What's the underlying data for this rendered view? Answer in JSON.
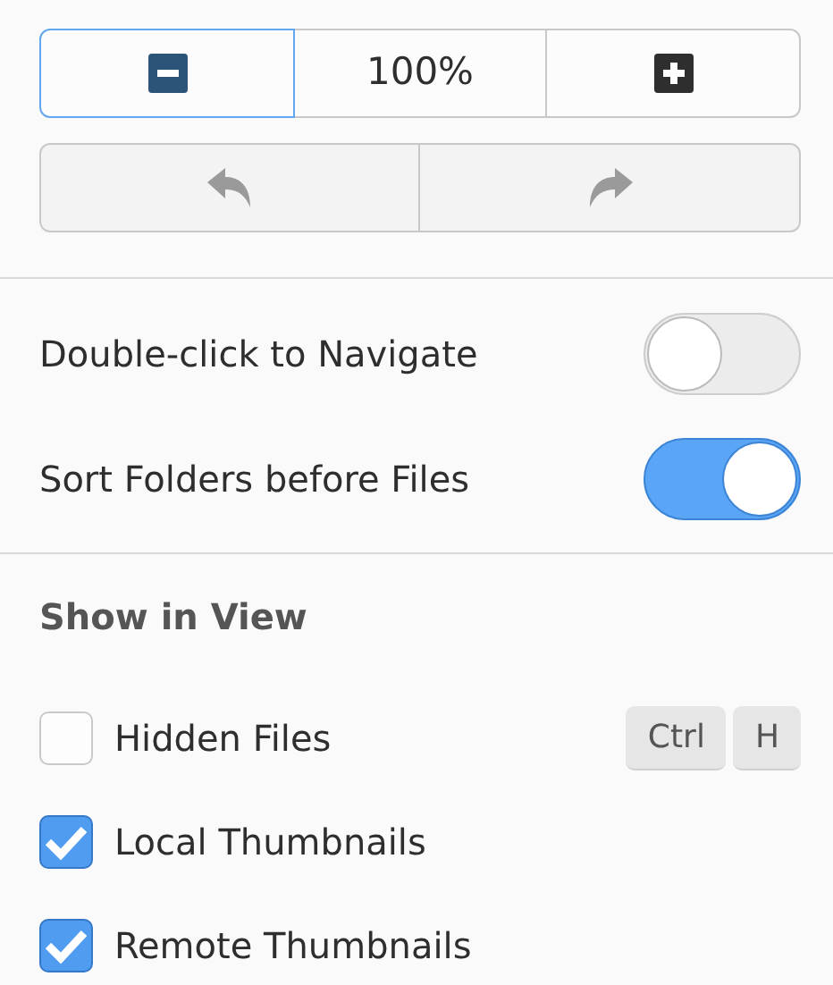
{
  "zoom_controls": {
    "zoom_out": {
      "focused": true
    },
    "zoom_level": "100%",
    "zoom_in": {
      "focused": false
    }
  },
  "history_buttons": [
    {
      "kind": "undo",
      "disabled": true
    },
    {
      "kind": "redo",
      "disabled": true
    }
  ],
  "toggles": [
    {
      "label": "Double-click to Navigate",
      "on": false
    },
    {
      "label": "Sort Folders before Files",
      "on": true
    }
  ],
  "show_in_view": {
    "heading": "Show in View",
    "options": [
      {
        "label": "Hidden Files",
        "checked": false,
        "shortcut": [
          "Ctrl",
          "H"
        ]
      },
      {
        "label": "Local Thumbnails",
        "checked": true
      },
      {
        "label": "Remote Thumbnails",
        "checked": true
      }
    ]
  }
}
